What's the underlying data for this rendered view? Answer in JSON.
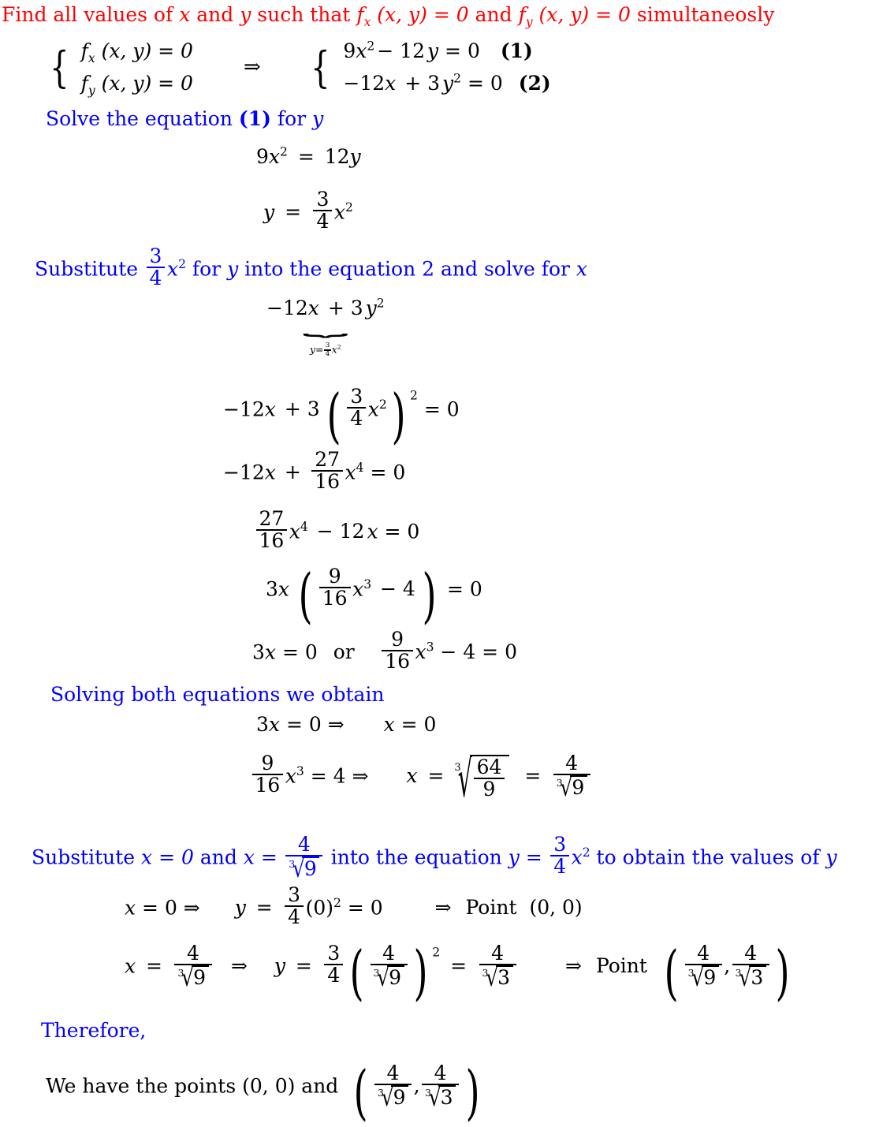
{
  "document": {
    "colors": {
      "heading": "#FF0000",
      "step_text": "#0000FF",
      "math": "#000000",
      "background": "#FFFFFF"
    },
    "title": {
      "prefix": "Find all values of ",
      "var_x": "x",
      "mid1": " and ",
      "var_y": "y",
      "mid2": " such that ",
      "fx": "f",
      "fx_sub": "x",
      "fx_args": " (x, y) = 0",
      "mid3": " and ",
      "fy": "f",
      "fy_sub": "y",
      "fy_args": " (x, y) = 0",
      "suffix": " simultaneosly"
    },
    "system": {
      "left": [
        {
          "f": "f",
          "sub": "x",
          "rest": "(x, y) = 0"
        },
        {
          "f": "f",
          "sub": "y",
          "rest": "(x, y) = 0"
        }
      ],
      "arrow": "⇒",
      "right": [
        {
          "eq_a": "9",
          "eq_x": "x",
          "eq_pow": "2",
          "eq_b": "− 12",
          "eq_y": "y",
          "eq_c": " = 0",
          "tag": "(1)"
        },
        {
          "eq_a": "−12",
          "eq_x": "x",
          "eq_b": " + 3",
          "eq_y": "y",
          "eq_pow": "2",
          "eq_c": " = 0",
          "tag": "(2)"
        }
      ]
    },
    "steps": [
      {
        "id": "solve-eq1",
        "text_a": "Solve the equation ",
        "tag": "(1)",
        "text_b": " for ",
        "var": "y"
      },
      {
        "id": "substitute-into-2",
        "text_a": "Substitute ",
        "frac_n": "3",
        "frac_d": "4",
        "var_sq": "x",
        "pow": "2",
        "text_b": " for ",
        "var_y": "y",
        "text_c": " into the equation 2 and solve for ",
        "var_x": "x"
      },
      {
        "id": "solving-both",
        "text_a": "Solving both equations we obtain"
      },
      {
        "id": "substitute-x-values",
        "text_a": "Substitute ",
        "x_eq_0": "x = 0",
        "text_b": " and ",
        "x_eq": "x = ",
        "num4": "4",
        "cbrt9_idx": "3",
        "cbrt9_rad": "9",
        "text_c": " into the equation ",
        "y_eq": "y = ",
        "frac_n": "3",
        "frac_d": "4",
        "var": "x",
        "pow": "2",
        "text_d": " to obtain the values of ",
        "var_y": "y"
      },
      {
        "id": "therefore",
        "text_a": "Therefore,"
      }
    ],
    "equations": {
      "e1": {
        "lhs_coef": "9",
        "lhs_var": "x",
        "lhs_pow": "2",
        "eq": " = ",
        "rhs": "12",
        "rhs_var": "y"
      },
      "e2": {
        "lhs": "y",
        "eq": " = ",
        "frac_n": "3",
        "frac_d": "4",
        "var": "x",
        "pow": "2"
      },
      "underbrace": {
        "expr_a": "−12",
        "expr_x": "x",
        "expr_b": " + 3",
        "expr_y": "y",
        "expr_pow": "2",
        "brace": "⏟",
        "label_lhs": "y=",
        "label_n": "3",
        "label_d": "4",
        "label_var": "x",
        "label_pow": "2"
      },
      "e3": {
        "a": "−12",
        "x": "x",
        "b": " + 3",
        "pn": "3",
        "pd": "4",
        "pvar": "x",
        "ppow": "2",
        "outer_pow": "2",
        "c": " = 0"
      },
      "e4": {
        "a": "−12",
        "x": "x",
        "b": " + ",
        "fn": "27",
        "fd": "16",
        "var": "x",
        "pow": "4",
        "c": " = 0"
      },
      "e5": {
        "fn": "27",
        "fd": "16",
        "var": "x",
        "pow": "4",
        "b": " − 12",
        "x2": "x",
        "c": " = 0"
      },
      "e6": {
        "a": "3",
        "x": "x",
        "fn": "9",
        "fd": "16",
        "var": "x",
        "pow": "3",
        "b": " − 4",
        "c": " = 0"
      },
      "e7": {
        "left": "3",
        "left_x": "x",
        "left_eq": " = 0",
        "or": "or",
        "fn": "9",
        "fd": "16",
        "var": "x",
        "pow": "3",
        "right_b": " − 4 = 0"
      },
      "e8": {
        "a": "3",
        "x": "x",
        "b": " = 0 ⇒",
        "gap_x": "x",
        "c": " = 0"
      },
      "e9": {
        "fn": "9",
        "fd": "16",
        "var": "x",
        "pow": "3",
        "b": " = 4 ⇒",
        "x": "x",
        "eq": " = ",
        "idx": "3",
        "rn": "64",
        "rd": "9",
        "eq2": " = ",
        "num": "4",
        "den_idx": "3",
        "den_rad": "9"
      },
      "p1": {
        "x": "x",
        "x_eq": " = 0  ⇒",
        "y": "y",
        "y_eq": " = ",
        "fn": "3",
        "fd": "4",
        "paren": "(0)",
        "pow": "2",
        "res": " = 0",
        "arrow": "⇒",
        "point_label": "Point",
        "point": "(0, 0)"
      },
      "p2": {
        "x": "x",
        "x_eq": " = ",
        "xn": "4",
        "xd_idx": "3",
        "xd_rad": "9",
        "arrow1": "⇒",
        "y": "y",
        "y_eq": " = ",
        "fn": "3",
        "fd": "4",
        "in_n": "4",
        "in_idx": "3",
        "in_rad": "9",
        "outer_pow": "2",
        "eq2": " = ",
        "rn": "4",
        "rd_idx": "3",
        "rd_rad": "3",
        "arrow2": "⇒",
        "point_label": "Point",
        "pt_n1": "4",
        "pt_d1_idx": "3",
        "pt_d1_rad": "9",
        "pt_n2": "4",
        "pt_d2_idx": "3",
        "pt_d2_rad": "3"
      },
      "conclusion": {
        "text_a": "We have the points ",
        "point1": "(0, 0)",
        "text_b": " and ",
        "pt_n1": "4",
        "pt_d1_idx": "3",
        "pt_d1_rad": "9",
        "pt_n2": "4",
        "pt_d2_idx": "3",
        "pt_d2_rad": "3"
      }
    }
  }
}
